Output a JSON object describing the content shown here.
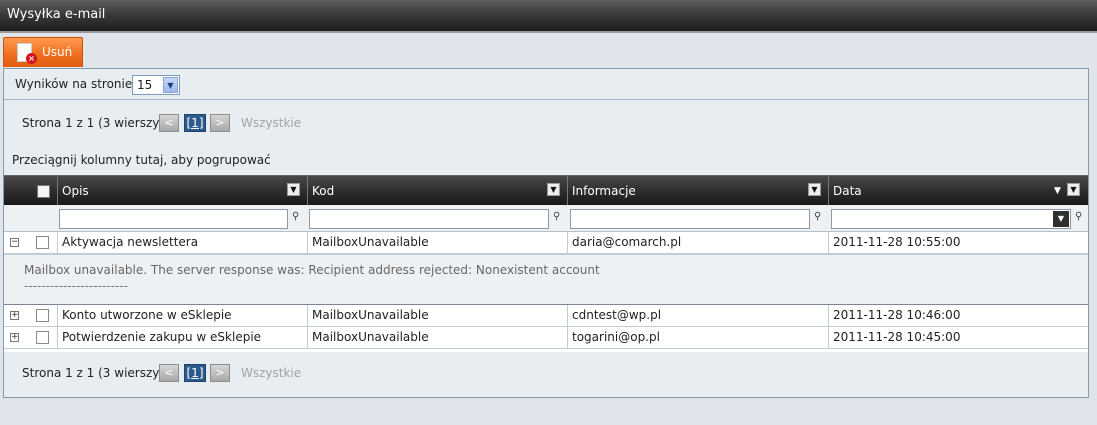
{
  "window": {
    "title": "Wysyłka e-mail"
  },
  "toolbar": {
    "delete_label": "Usuń"
  },
  "per_page": {
    "label": "Wyników na stronie:",
    "value": "15"
  },
  "pager": {
    "text": "Strona 1 z 1 (3 wierszy)",
    "prev": "<",
    "current": "[1]",
    "next": ">",
    "all": "Wszystkie"
  },
  "group_hint": "Przeciągnij kolumny tutaj, aby pogrupować",
  "columns": {
    "opis": "Opis",
    "kod": "Kod",
    "informacje": "Informacje",
    "data": "Data"
  },
  "rows": [
    {
      "opis": "Aktywacja newslettera",
      "kod": "MailboxUnavailable",
      "informacje": "daria@comarch.pl",
      "data": "2011-11-28 10:55:00",
      "expanded": true
    },
    {
      "opis": "Konto utworzone w eSklepie",
      "kod": "MailboxUnavailable",
      "informacje": "cdntest@wp.pl",
      "data": "2011-11-28 10:46:00",
      "expanded": false
    },
    {
      "opis": "Potwierdzenie zakupu w eSklepie",
      "kod": "MailboxUnavailable",
      "informacje": "togarini@op.pl",
      "data": "2011-11-28 10:45:00",
      "expanded": false
    }
  ],
  "detail": {
    "message": "Mailbox unavailable. The server response was: Recipient address rejected: Nonexistent account",
    "separator": "------------------------"
  },
  "icons": {
    "expand_collapsed": "+",
    "expand_expanded": "−",
    "filter": "⚲",
    "menu": "▼",
    "sort_desc": "▼",
    "select_arrow": "▼"
  }
}
